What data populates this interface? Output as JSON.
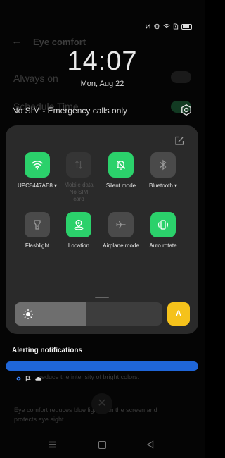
{
  "status_bar": {
    "icons": [
      "nfc-icon",
      "vibrate-icon",
      "wifi-icon",
      "no-sim-icon",
      "battery-icon"
    ]
  },
  "background_screen": {
    "title": "Eye comfort",
    "row1_label": "Always on",
    "row2_label": "Schedule Time",
    "paragraph1": "reduce the intensity of bright colors.",
    "paragraph2": "Eye comfort reduces blue light from the screen and protects eye sight."
  },
  "lock_info": {
    "time": "14:07",
    "date": "Mon, Aug 22",
    "sim_status": "No SIM - Emergency calls only"
  },
  "quick_settings": {
    "tiles": [
      {
        "label": "UPC8447AE8",
        "icon": "wifi-icon",
        "state": "on",
        "has_menu": true
      },
      {
        "label": "Mobile data No SIM card",
        "icon": "mobile-data-icon",
        "state": "unavailable",
        "has_menu": false
      },
      {
        "label": "Silent mode",
        "icon": "silent-bell-icon",
        "state": "on",
        "has_menu": false
      },
      {
        "label": "Bluetooth",
        "icon": "bluetooth-icon",
        "state": "off",
        "has_menu": true
      },
      {
        "label": "Flashlight",
        "icon": "flashlight-icon",
        "state": "off",
        "has_menu": false
      },
      {
        "label": "Location",
        "icon": "location-icon",
        "state": "on",
        "has_menu": false
      },
      {
        "label": "Airplane mode",
        "icon": "airplane-icon",
        "state": "off",
        "has_menu": false
      },
      {
        "label": "Auto rotate",
        "icon": "rotate-icon",
        "state": "on",
        "has_menu": false
      }
    ],
    "brightness_level": 0.48,
    "auto_brightness_label": "A"
  },
  "notification": {
    "title": "Alerting notifications"
  },
  "colors": {
    "tile_on": "#2bd16b",
    "tile_off": "#4a4a4a",
    "auto_brightness": "#f5c21b",
    "progress": "#1f66d9"
  }
}
